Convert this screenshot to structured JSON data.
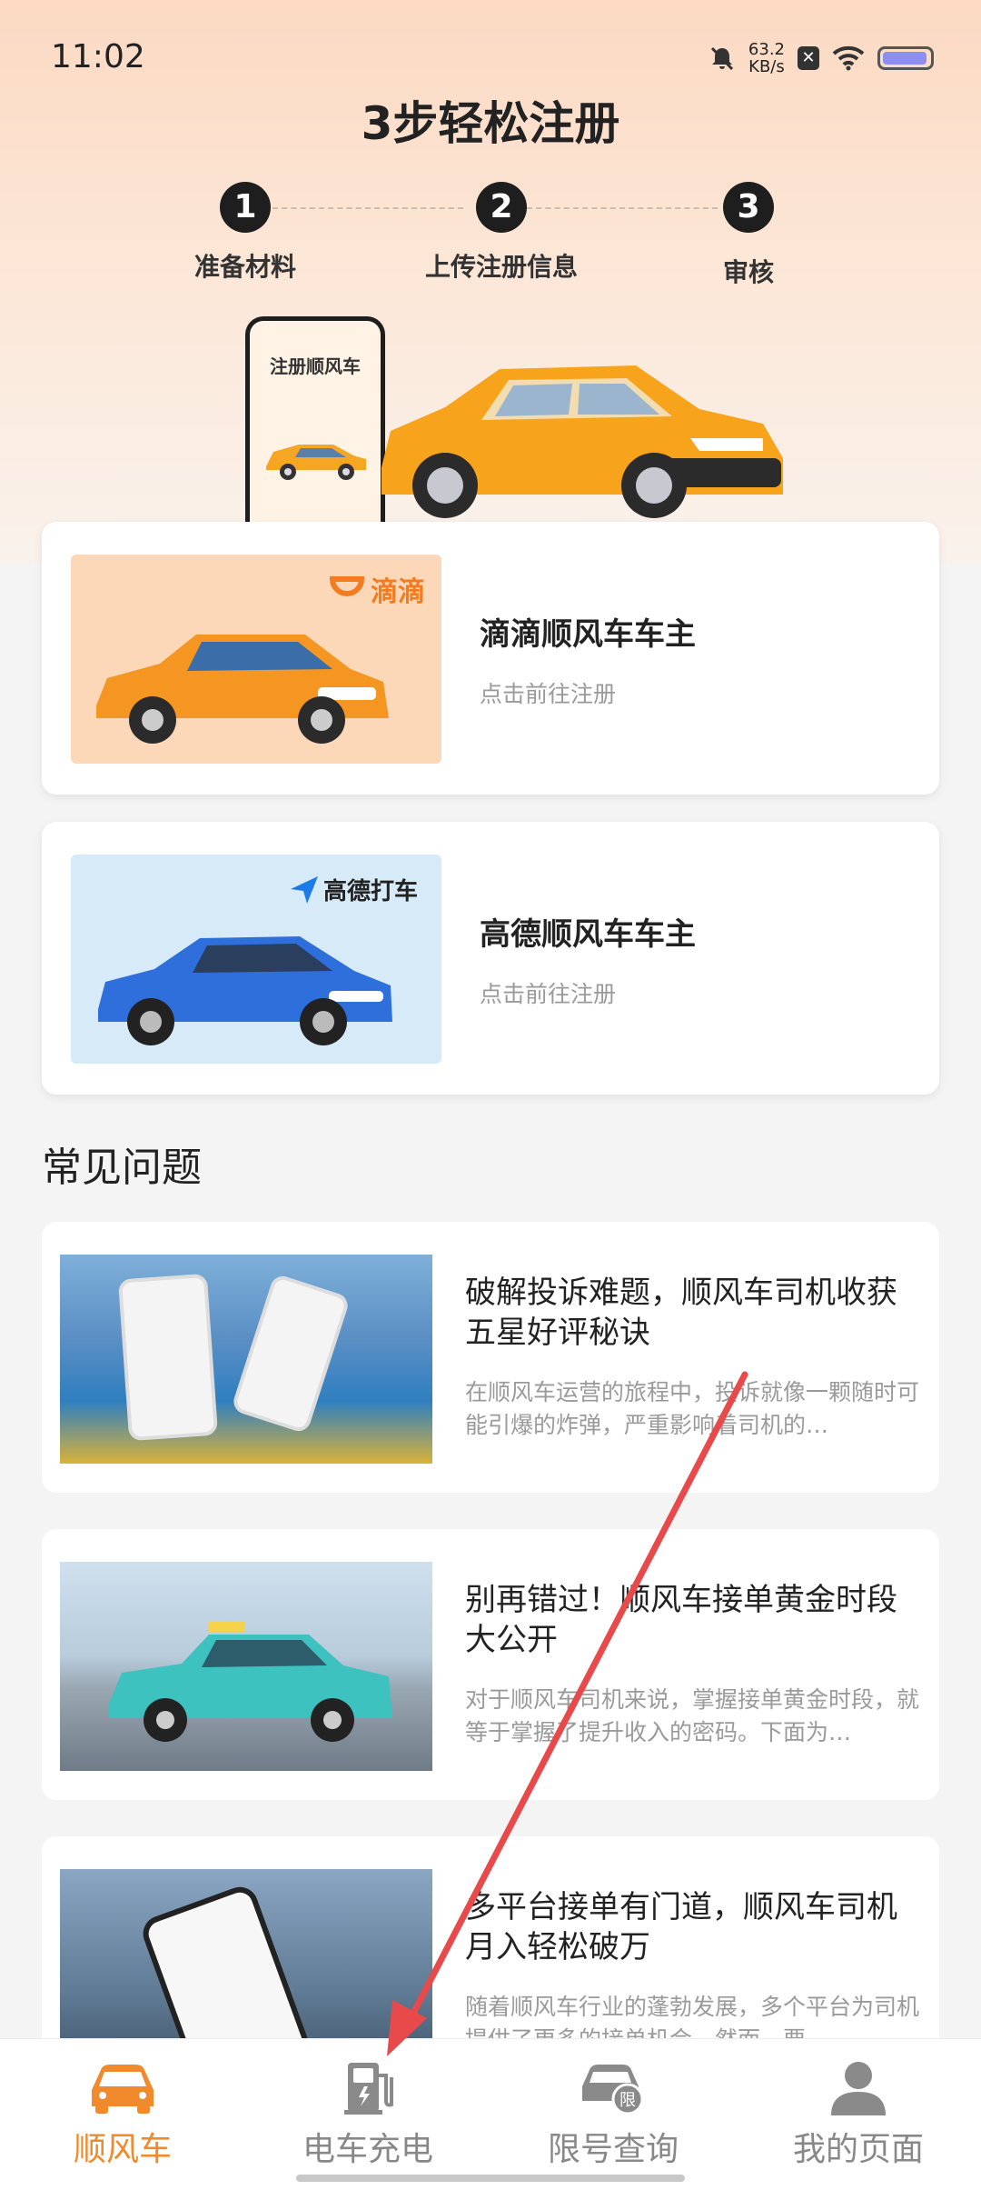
{
  "status": {
    "time": "11:02",
    "speed_value": "63.2",
    "speed_unit": "KB/s"
  },
  "hero": {
    "title": "3步轻松注册",
    "steps": [
      {
        "num": "1",
        "label": "准备材料"
      },
      {
        "num": "2",
        "label": "上传注册信息"
      },
      {
        "num": "3",
        "label": "审核"
      }
    ],
    "phone_label": "注册顺风车"
  },
  "cards": [
    {
      "title": "滴滴顺风车车主",
      "subtitle": "点击前往注册",
      "brand": "滴滴"
    },
    {
      "title": "高德顺风车车主",
      "subtitle": "点击前往注册",
      "brand": "高德打车"
    }
  ],
  "faq": {
    "title": "常见问题",
    "articles": [
      {
        "title": "破解投诉难题，顺风车司机收获五星好评秘诀",
        "desc": "在顺风车运营的旅程中，投诉就像一颗随时可能引爆的炸弹，严重影响着司机的…"
      },
      {
        "title": "别再错过！顺风车接单黄金时段大公开",
        "desc": "对于顺风车司机来说，掌握接单黄金时段，就等于掌握了提升收入的密码。下面为…"
      },
      {
        "title": "多平台接单有门道，顺风车司机月入轻松破万",
        "desc": "随着顺风车行业的蓬勃发展，多个平台为司机提供了更多的接单机会。然而，要…"
      }
    ]
  },
  "tabs": [
    {
      "label": "顺风车",
      "icon": "car-icon",
      "active": true
    },
    {
      "label": "电车充电",
      "icon": "charging-station-icon",
      "active": false
    },
    {
      "label": "限号查询",
      "icon": "restricted-car-icon",
      "active": false
    },
    {
      "label": "我的页面",
      "icon": "user-icon",
      "active": false
    }
  ],
  "colors": {
    "accent": "#f08a2c",
    "inactive_tab": "#888888",
    "hero_top": "#fbd9c2",
    "annotation_arrow": "#e8494a"
  },
  "battery_level": 0.95
}
